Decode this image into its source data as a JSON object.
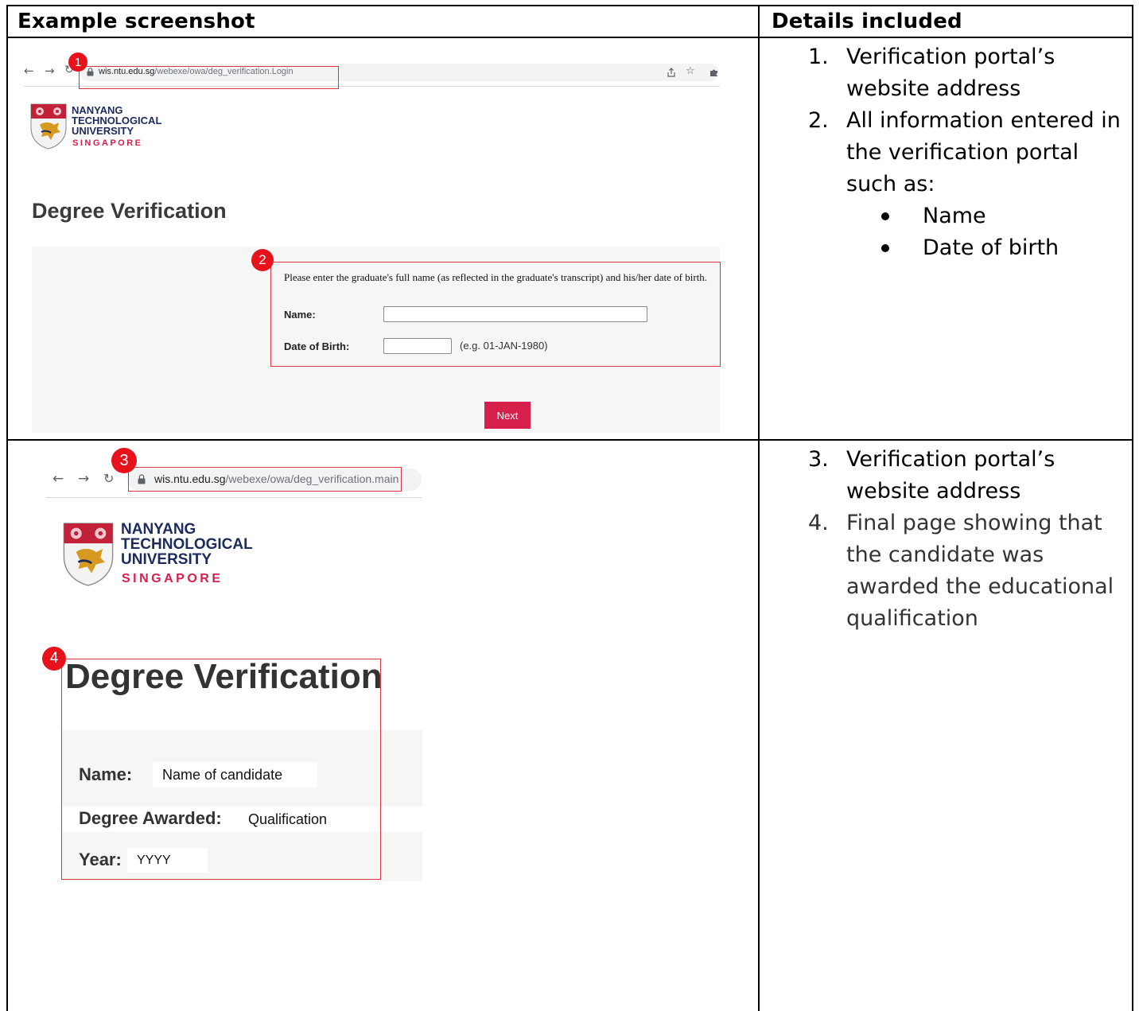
{
  "headers": {
    "left": "Example screenshot",
    "right": "Details included"
  },
  "row1": {
    "details": [
      {
        "num": "1.",
        "text": "Verification portal’s website address"
      },
      {
        "num": "2.",
        "text": "All information entered in the verification portal such as:"
      }
    ],
    "sub_bullets": [
      "Name",
      "Date of birth"
    ],
    "screenshot": {
      "badge1": "1",
      "badge2": "2",
      "url_host": "wis.ntu.edu.sg",
      "url_path": "/webexe/owa/deg_verification.Login",
      "logo_lines": [
        "NANYANG",
        "TECHNOLOGICAL",
        "UNIVERSITY"
      ],
      "logo_sub": "SINGAPORE",
      "title": "Degree Verification",
      "instruction": "Please enter the graduate's full name (as reflected in the graduate's transcript) and his/her date of birth.",
      "name_label": "Name:",
      "dob_label": "Date of Birth:",
      "dob_hint": "(e.g. 01-JAN-1980)",
      "next_label": "Next"
    }
  },
  "row2": {
    "details": [
      {
        "num": "3.",
        "text": "Verification portal’s website address"
      },
      {
        "num": "4.",
        "text": "Final page showing that the candidate was awarded the educational qualification"
      }
    ],
    "screenshot": {
      "badge3": "3",
      "badge4": "4",
      "url_host": "wis.ntu.edu.sg",
      "url_path": "/webexe/owa/deg_verification.main",
      "logo_lines": [
        "NANYANG",
        "TECHNOLOGICAL",
        "UNIVERSITY"
      ],
      "logo_sub": "SINGAPORE",
      "title": "Degree Verification",
      "name_label": "Name:",
      "name_value": "Name of candidate",
      "degree_label": "Degree Awarded:",
      "degree_value": "Qualification",
      "year_label": "Year:",
      "year_value": "YYYY"
    }
  },
  "icons": [
    "back-arrow-icon",
    "forward-arrow-icon",
    "reload-icon",
    "lock-icon",
    "share-icon",
    "star-icon",
    "extension-icon",
    "ntu-crest-icon"
  ],
  "colors": {
    "accent_red": "#d71f4b",
    "annotation_red": "#e8121d",
    "logo_navy": "#1c2a5c"
  }
}
